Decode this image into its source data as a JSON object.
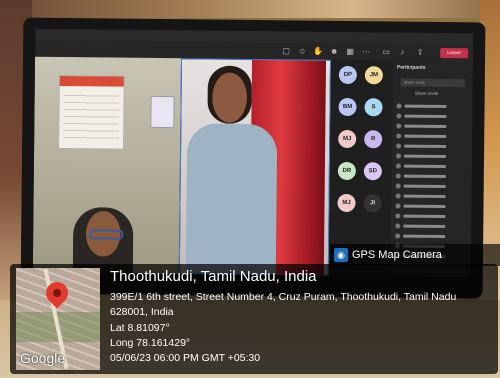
{
  "meeting": {
    "window_title": "",
    "leave_label": "Leave",
    "participants_title": "Participants",
    "invite_placeholder": "Share invite",
    "share_label": "Share invite",
    "avatars": [
      {
        "initials": "DP",
        "color": "#b7c7f2"
      },
      {
        "initials": "JM",
        "color": "#f0d99a"
      },
      {
        "initials": "BM",
        "color": "#b7c7f2"
      },
      {
        "initials": "S",
        "color": "#a9d9f0"
      },
      {
        "initials": "MJ",
        "color": "#f0c9c9"
      },
      {
        "initials": "R",
        "color": "#c9b7f0"
      },
      {
        "initials": "DR",
        "color": "#c7e7c7"
      },
      {
        "initials": "SD",
        "color": "#d9c7f0"
      },
      {
        "initials": "MJ",
        "color": "#f0c9c9"
      },
      {
        "initials": "JI",
        "color": "#333333"
      }
    ]
  },
  "gps": {
    "badge_label": "GPS Map Camera",
    "location_title": "Thoothukudi, Tamil Nadu, India",
    "address": "399E/1 6th street, Street Number 4, Cruz Puram, Thoothukudi, Tamil Nadu 628001, India",
    "lat": "Lat 8.81097°",
    "long": "Long 78.161429°",
    "timestamp": "05/06/23 06:00 PM GMT +05:30",
    "map_brand": "Google",
    "colors": {
      "pin": "#e23b2e",
      "panel": "#000000"
    }
  }
}
